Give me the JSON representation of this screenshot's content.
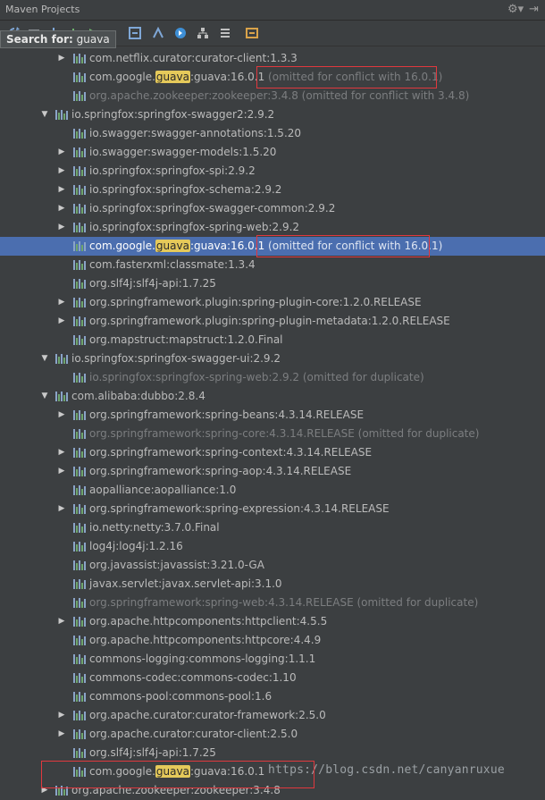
{
  "window": {
    "title": "Maven Projects"
  },
  "toolbar": {
    "icons": [
      "refresh-icon",
      "generate-icon",
      "download-icon",
      "add-icon",
      "run-icon",
      "execute-goal-icon",
      "toggle-offline-icon",
      "lifecycle-icon",
      "show-dependencies-icon",
      "collapse-all-icon",
      "settings-icon"
    ]
  },
  "search": {
    "label": "Search for:",
    "query": "guava"
  },
  "colors": {
    "selection": "#4b6eaf",
    "highlight": "#e5c95a",
    "red_box": "#e0383e"
  },
  "tree": [
    {
      "indent": 2,
      "arrow": "right",
      "pre": "com.netflix.curator:curator-client:1.3.3",
      "hl": "",
      "post": "",
      "note": "",
      "dim": false,
      "sel": false
    },
    {
      "indent": 2,
      "arrow": "",
      "pre": "com.google.",
      "hl": "guava",
      "post": ":guava:16.0.1",
      "note": " (omitted for conflict with 16.0.1)",
      "dim": false,
      "sel": false
    },
    {
      "indent": 2,
      "arrow": "",
      "pre": "org.apache.zookeeper:zookeeper:3.4.8 (omitted for conflict with 3.4.8)",
      "hl": "",
      "post": "",
      "note": "",
      "dim": true,
      "sel": false
    },
    {
      "indent": 1,
      "arrow": "down",
      "pre": "io.springfox:springfox-swagger2:2.9.2",
      "hl": "",
      "post": "",
      "note": "",
      "dim": false,
      "sel": false
    },
    {
      "indent": 2,
      "arrow": "",
      "pre": "io.swagger:swagger-annotations:1.5.20",
      "hl": "",
      "post": "",
      "note": "",
      "dim": false,
      "sel": false
    },
    {
      "indent": 2,
      "arrow": "right",
      "pre": "io.swagger:swagger-models:1.5.20",
      "hl": "",
      "post": "",
      "note": "",
      "dim": false,
      "sel": false
    },
    {
      "indent": 2,
      "arrow": "right",
      "pre": "io.springfox:springfox-spi:2.9.2",
      "hl": "",
      "post": "",
      "note": "",
      "dim": false,
      "sel": false
    },
    {
      "indent": 2,
      "arrow": "right",
      "pre": "io.springfox:springfox-schema:2.9.2",
      "hl": "",
      "post": "",
      "note": "",
      "dim": false,
      "sel": false
    },
    {
      "indent": 2,
      "arrow": "right",
      "pre": "io.springfox:springfox-swagger-common:2.9.2",
      "hl": "",
      "post": "",
      "note": "",
      "dim": false,
      "sel": false
    },
    {
      "indent": 2,
      "arrow": "right",
      "pre": "io.springfox:springfox-spring-web:2.9.2",
      "hl": "",
      "post": "",
      "note": "",
      "dim": false,
      "sel": false
    },
    {
      "indent": 2,
      "arrow": "",
      "pre": "com.google.",
      "hl": "guava",
      "post": ":guava:16.0.1",
      "note": " (omitted for conflict with 16.0.1)",
      "dim": false,
      "sel": true
    },
    {
      "indent": 2,
      "arrow": "",
      "pre": "com.fasterxml:classmate:1.3.4",
      "hl": "",
      "post": "",
      "note": "",
      "dim": false,
      "sel": false
    },
    {
      "indent": 2,
      "arrow": "",
      "pre": "org.slf4j:slf4j-api:1.7.25",
      "hl": "",
      "post": "",
      "note": "",
      "dim": false,
      "sel": false
    },
    {
      "indent": 2,
      "arrow": "right",
      "pre": "org.springframework.plugin:spring-plugin-core:1.2.0.RELEASE",
      "hl": "",
      "post": "",
      "note": "",
      "dim": false,
      "sel": false
    },
    {
      "indent": 2,
      "arrow": "right",
      "pre": "org.springframework.plugin:spring-plugin-metadata:1.2.0.RELEASE",
      "hl": "",
      "post": "",
      "note": "",
      "dim": false,
      "sel": false
    },
    {
      "indent": 2,
      "arrow": "",
      "pre": "org.mapstruct:mapstruct:1.2.0.Final",
      "hl": "",
      "post": "",
      "note": "",
      "dim": false,
      "sel": false
    },
    {
      "indent": 1,
      "arrow": "down",
      "pre": "io.springfox:springfox-swagger-ui:2.9.2",
      "hl": "",
      "post": "",
      "note": "",
      "dim": false,
      "sel": false
    },
    {
      "indent": 2,
      "arrow": "",
      "pre": "io.springfox:springfox-spring-web:2.9.2 (omitted for duplicate)",
      "hl": "",
      "post": "",
      "note": "",
      "dim": true,
      "sel": false
    },
    {
      "indent": 1,
      "arrow": "down",
      "pre": "com.alibaba:dubbo:2.8.4",
      "hl": "",
      "post": "",
      "note": "",
      "dim": false,
      "sel": false
    },
    {
      "indent": 2,
      "arrow": "right",
      "pre": "org.springframework:spring-beans:4.3.14.RELEASE",
      "hl": "",
      "post": "",
      "note": "",
      "dim": false,
      "sel": false
    },
    {
      "indent": 2,
      "arrow": "",
      "pre": "org.springframework:spring-core:4.3.14.RELEASE (omitted for duplicate)",
      "hl": "",
      "post": "",
      "note": "",
      "dim": true,
      "sel": false
    },
    {
      "indent": 2,
      "arrow": "right",
      "pre": "org.springframework:spring-context:4.3.14.RELEASE",
      "hl": "",
      "post": "",
      "note": "",
      "dim": false,
      "sel": false
    },
    {
      "indent": 2,
      "arrow": "right",
      "pre": "org.springframework:spring-aop:4.3.14.RELEASE",
      "hl": "",
      "post": "",
      "note": "",
      "dim": false,
      "sel": false
    },
    {
      "indent": 2,
      "arrow": "",
      "pre": "aopalliance:aopalliance:1.0",
      "hl": "",
      "post": "",
      "note": "",
      "dim": false,
      "sel": false
    },
    {
      "indent": 2,
      "arrow": "right",
      "pre": "org.springframework:spring-expression:4.3.14.RELEASE",
      "hl": "",
      "post": "",
      "note": "",
      "dim": false,
      "sel": false
    },
    {
      "indent": 2,
      "arrow": "",
      "pre": "io.netty:netty:3.7.0.Final",
      "hl": "",
      "post": "",
      "note": "",
      "dim": false,
      "sel": false
    },
    {
      "indent": 2,
      "arrow": "",
      "pre": "log4j:log4j:1.2.16",
      "hl": "",
      "post": "",
      "note": "",
      "dim": false,
      "sel": false
    },
    {
      "indent": 2,
      "arrow": "",
      "pre": "org.javassist:javassist:3.21.0-GA",
      "hl": "",
      "post": "",
      "note": "",
      "dim": false,
      "sel": false
    },
    {
      "indent": 2,
      "arrow": "",
      "pre": "javax.servlet:javax.servlet-api:3.1.0",
      "hl": "",
      "post": "",
      "note": "",
      "dim": false,
      "sel": false
    },
    {
      "indent": 2,
      "arrow": "",
      "pre": "org.springframework:spring-web:4.3.14.RELEASE (omitted for duplicate)",
      "hl": "",
      "post": "",
      "note": "",
      "dim": true,
      "sel": false
    },
    {
      "indent": 2,
      "arrow": "right",
      "pre": "org.apache.httpcomponents:httpclient:4.5.5",
      "hl": "",
      "post": "",
      "note": "",
      "dim": false,
      "sel": false
    },
    {
      "indent": 2,
      "arrow": "",
      "pre": "org.apache.httpcomponents:httpcore:4.4.9",
      "hl": "",
      "post": "",
      "note": "",
      "dim": false,
      "sel": false
    },
    {
      "indent": 2,
      "arrow": "",
      "pre": "commons-logging:commons-logging:1.1.1",
      "hl": "",
      "post": "",
      "note": "",
      "dim": false,
      "sel": false
    },
    {
      "indent": 2,
      "arrow": "",
      "pre": "commons-codec:commons-codec:1.10",
      "hl": "",
      "post": "",
      "note": "",
      "dim": false,
      "sel": false
    },
    {
      "indent": 2,
      "arrow": "",
      "pre": "commons-pool:commons-pool:1.6",
      "hl": "",
      "post": "",
      "note": "",
      "dim": false,
      "sel": false
    },
    {
      "indent": 2,
      "arrow": "right",
      "pre": "org.apache.curator:curator-framework:2.5.0",
      "hl": "",
      "post": "",
      "note": "",
      "dim": false,
      "sel": false
    },
    {
      "indent": 2,
      "arrow": "right",
      "pre": "org.apache.curator:curator-client:2.5.0",
      "hl": "",
      "post": "",
      "note": "",
      "dim": false,
      "sel": false
    },
    {
      "indent": 2,
      "arrow": "",
      "pre": "org.slf4j:slf4j-api:1.7.25",
      "hl": "",
      "post": "",
      "note": "",
      "dim": false,
      "sel": false
    },
    {
      "indent": 2,
      "arrow": "",
      "pre": "com.google.",
      "hl": "guava",
      "post": ":guava:16.0.1",
      "note": "",
      "dim": false,
      "sel": false
    },
    {
      "indent": 1,
      "arrow": "right",
      "pre": "org.apache.zookeeper:zookeeper:3.4.8",
      "hl": "",
      "post": "",
      "note": "",
      "dim": false,
      "sel": false
    }
  ],
  "watermark": "https://blog.csdn.net/canyanruxue"
}
